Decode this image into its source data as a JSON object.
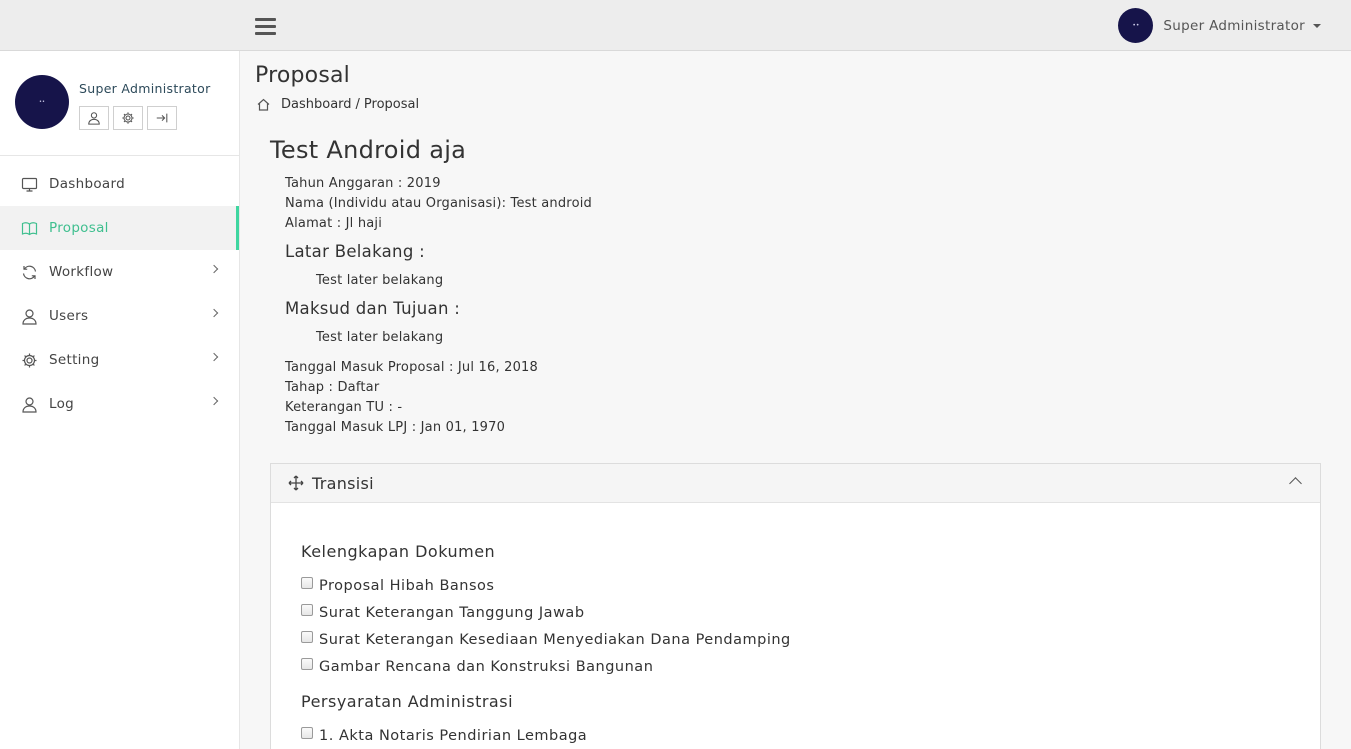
{
  "topbar": {
    "user_name": "Super Administrator",
    "avatar_text": "••"
  },
  "sidebar": {
    "profile_name": "Super Administrator",
    "avatar_text": "••",
    "items": [
      {
        "label": "Dashboard",
        "icon": "monitor-icon"
      },
      {
        "label": "Proposal",
        "icon": "book-icon"
      },
      {
        "label": "Workflow",
        "icon": "refresh-icon"
      },
      {
        "label": "Users",
        "icon": "user-icon"
      },
      {
        "label": "Setting",
        "icon": "gear-icon"
      },
      {
        "label": "Log",
        "icon": "user-icon"
      }
    ]
  },
  "header": {
    "title": "Proposal",
    "breadcrumb": {
      "home": "Dashboard",
      "separator": "/",
      "current": "Proposal"
    }
  },
  "record": {
    "title": "Test Android aja",
    "tahun": "Tahun Anggaran : 2019",
    "nama": "Nama (Individu atau Organisasi): Test android",
    "alamat": "Alamat : Jl haji",
    "latar_heading": "Latar Belakang :",
    "latar_text": "Test later belakang",
    "maksud_heading": "Maksud dan Tujuan :",
    "maksud_text": "Test later belakang",
    "tanggal_masuk": "Tanggal Masuk Proposal : Jul 16, 2018",
    "tahap": "Tahap : Daftar",
    "keterangan": "Keterangan TU : -",
    "tanggal_lpj": "Tanggal Masuk LPJ : Jan 01, 1970"
  },
  "transisi": {
    "title": "Transisi",
    "sections": [
      {
        "title": "Kelengkapan Dokumen",
        "items": [
          "Proposal Hibah Bansos",
          "Surat Keterangan Tanggung Jawab",
          "Surat Keterangan Kesediaan Menyediakan Dana Pendamping",
          "Gambar Rencana dan Konstruksi Bangunan"
        ]
      },
      {
        "title": "Persyaratan Administrasi",
        "items": [
          "1. Akta Notaris Pendirian Lembaga"
        ]
      }
    ]
  },
  "colors": {
    "accent": "#3fd6a0",
    "avatar_bg": "#16144a"
  }
}
